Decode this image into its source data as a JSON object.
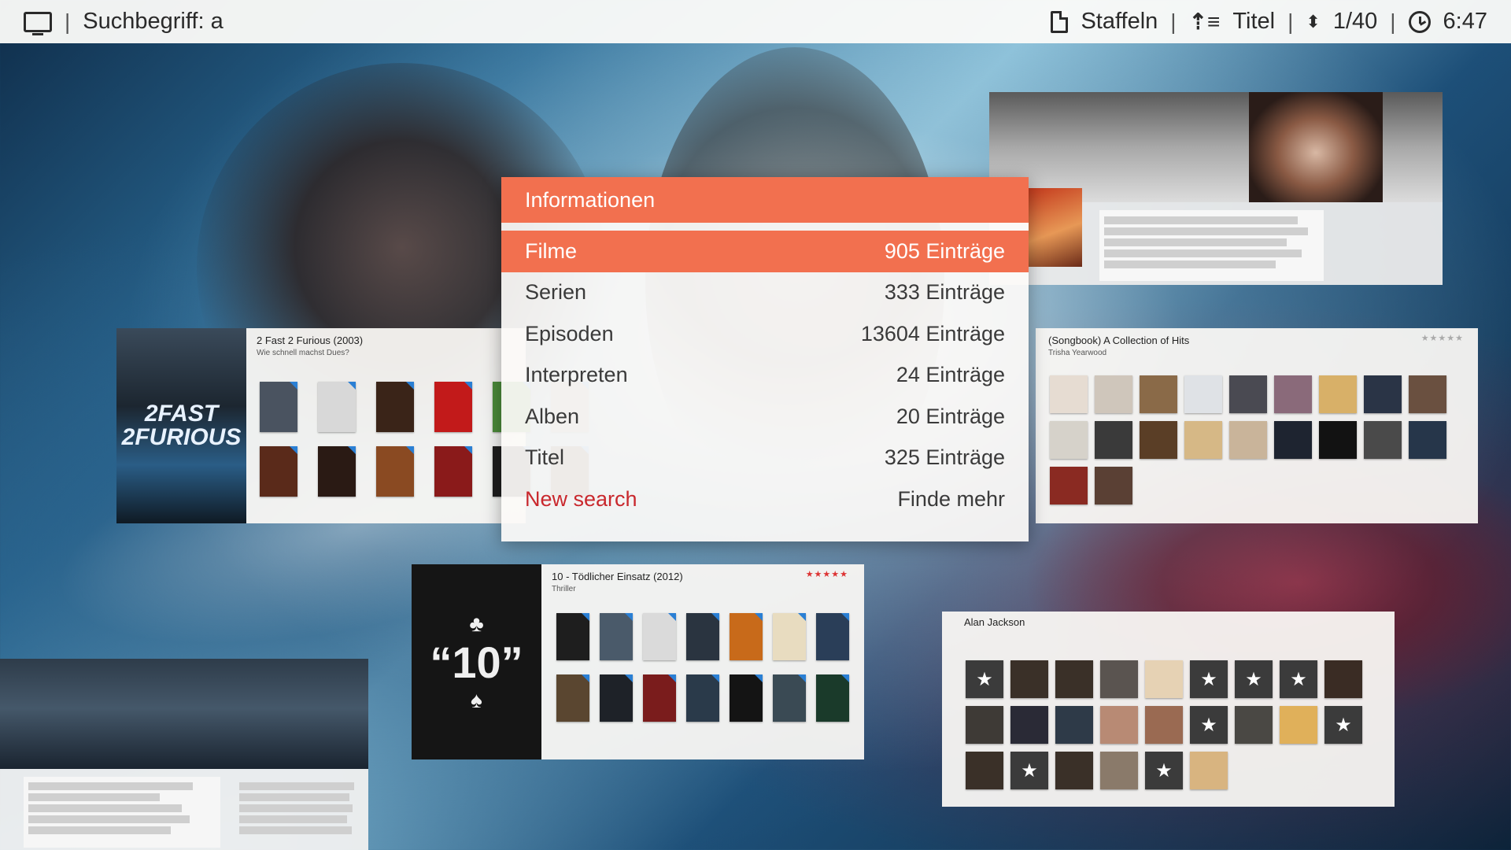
{
  "topbar": {
    "search_label": "Suchbegriff: a",
    "view_label": "Staffeln",
    "sort_label": "Titel",
    "position": "1/40",
    "clock": "6:47"
  },
  "dialog": {
    "title": "Informationen",
    "items": [
      {
        "label": "Filme",
        "value": "905 Einträge",
        "selected": true
      },
      {
        "label": "Serien",
        "value": "333 Einträge"
      },
      {
        "label": "Episoden",
        "value": "13604 Einträge"
      },
      {
        "label": "Interpreten",
        "value": "24 Einträge"
      },
      {
        "label": "Alben",
        "value": "20 Einträge"
      },
      {
        "label": "Titel",
        "value": "325 Einträge"
      },
      {
        "label": "New search",
        "value": "Finde mehr"
      }
    ]
  },
  "panels": {
    "fast_furious": {
      "title": "2 Fast 2 Furious (2003)",
      "subtitle": "Wie schnell machst Dues?",
      "poster_text": "2FAST 2FURIOUS"
    },
    "songbook": {
      "title": "(Songbook) A Collection of Hits",
      "subtitle": "Trisha Yearwood",
      "rating": "★★★★★"
    },
    "ten": {
      "title": "10 - Tödlicher Einsatz (2012)",
      "subtitle": "Thriller",
      "rating": "★★★★★",
      "poster_text": "“10”"
    },
    "alan_jackson": {
      "title": "Alan Jackson"
    }
  },
  "colors": {
    "accent": "#f2704f",
    "new_search": "#c9282d"
  },
  "icons": {
    "tv": "tv-icon",
    "doc": "document-icon",
    "sort": "sort-icon",
    "updown": "up-down-icon",
    "clock": "clock-icon"
  }
}
